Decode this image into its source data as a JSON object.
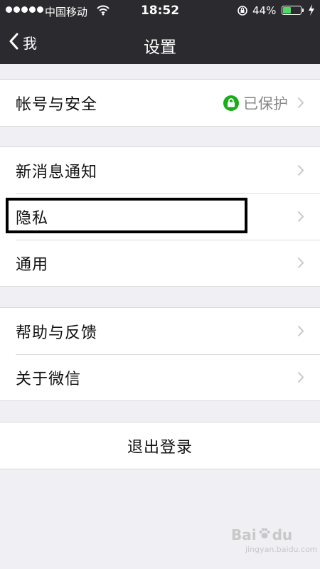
{
  "status_bar": {
    "carrier": "中国移动",
    "time": "18:52",
    "battery_percent": "44%",
    "battery_level": 0.44,
    "signal_bars": 5
  },
  "nav": {
    "back_label": "我",
    "title": "设置"
  },
  "groups": [
    {
      "items": [
        {
          "label": "帐号与安全",
          "value": "已保护",
          "icon": "lock-icon"
        }
      ]
    },
    {
      "items": [
        {
          "label": "新消息通知"
        },
        {
          "label": "隐私"
        },
        {
          "label": "通用"
        }
      ]
    },
    {
      "items": [
        {
          "label": "帮助与反馈"
        },
        {
          "label": "关于微信"
        }
      ]
    }
  ],
  "logout": {
    "label": "退出登录"
  },
  "watermark": {
    "text": "Bai",
    "paw": "du",
    "sub": "jingyan.baidu.com"
  },
  "colors": {
    "nav_background": "#2b2b2f",
    "page_background": "#efeff4",
    "protected_green": "#1aad19",
    "battery_green": "#4cd964"
  }
}
